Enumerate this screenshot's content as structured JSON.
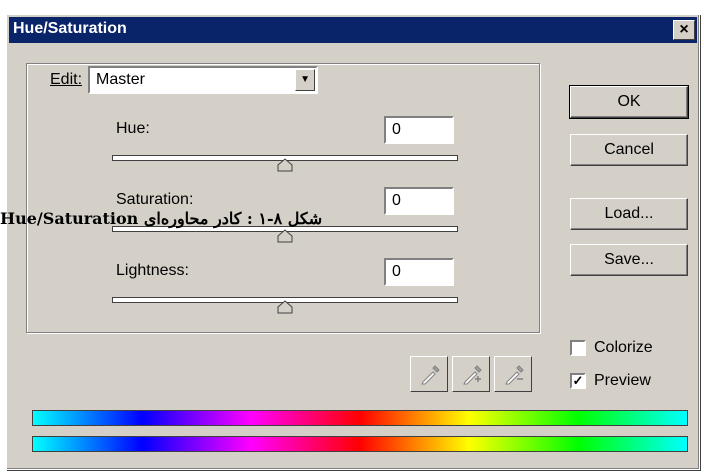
{
  "dialog": {
    "title": "Hue/Saturation",
    "close_glyph": "×"
  },
  "edit": {
    "label": "Edit:",
    "value": "Master"
  },
  "sliders": [
    {
      "label": "Hue:",
      "value": "0",
      "level": 0.5
    },
    {
      "label": "Saturation:",
      "value": "0",
      "level": 0.5
    },
    {
      "label": "Lightness:",
      "value": "0",
      "level": 0.5
    }
  ],
  "buttons": {
    "ok": "OK",
    "cancel": "Cancel",
    "load": "Load...",
    "save": "Save..."
  },
  "options": {
    "colorize": {
      "label": "Colorize",
      "checked": false
    },
    "preview": {
      "label": "Preview",
      "checked": true
    }
  },
  "eyedroppers": [
    "eyedropper-icon",
    "eyedropper-plus-icon",
    "eyedropper-minus-icon"
  ],
  "caption": "شکل ۸-۱ : کادر محاوره‌ای Hue/Saturation",
  "colors": {
    "titlebar": "#0a246a",
    "dialog_bg": "#d4d0c8",
    "spectrum": [
      "#00ffff",
      "#0000ff",
      "#ff00ff",
      "#ff0000",
      "#ffff00",
      "#00ff00",
      "#00ffff"
    ]
  }
}
